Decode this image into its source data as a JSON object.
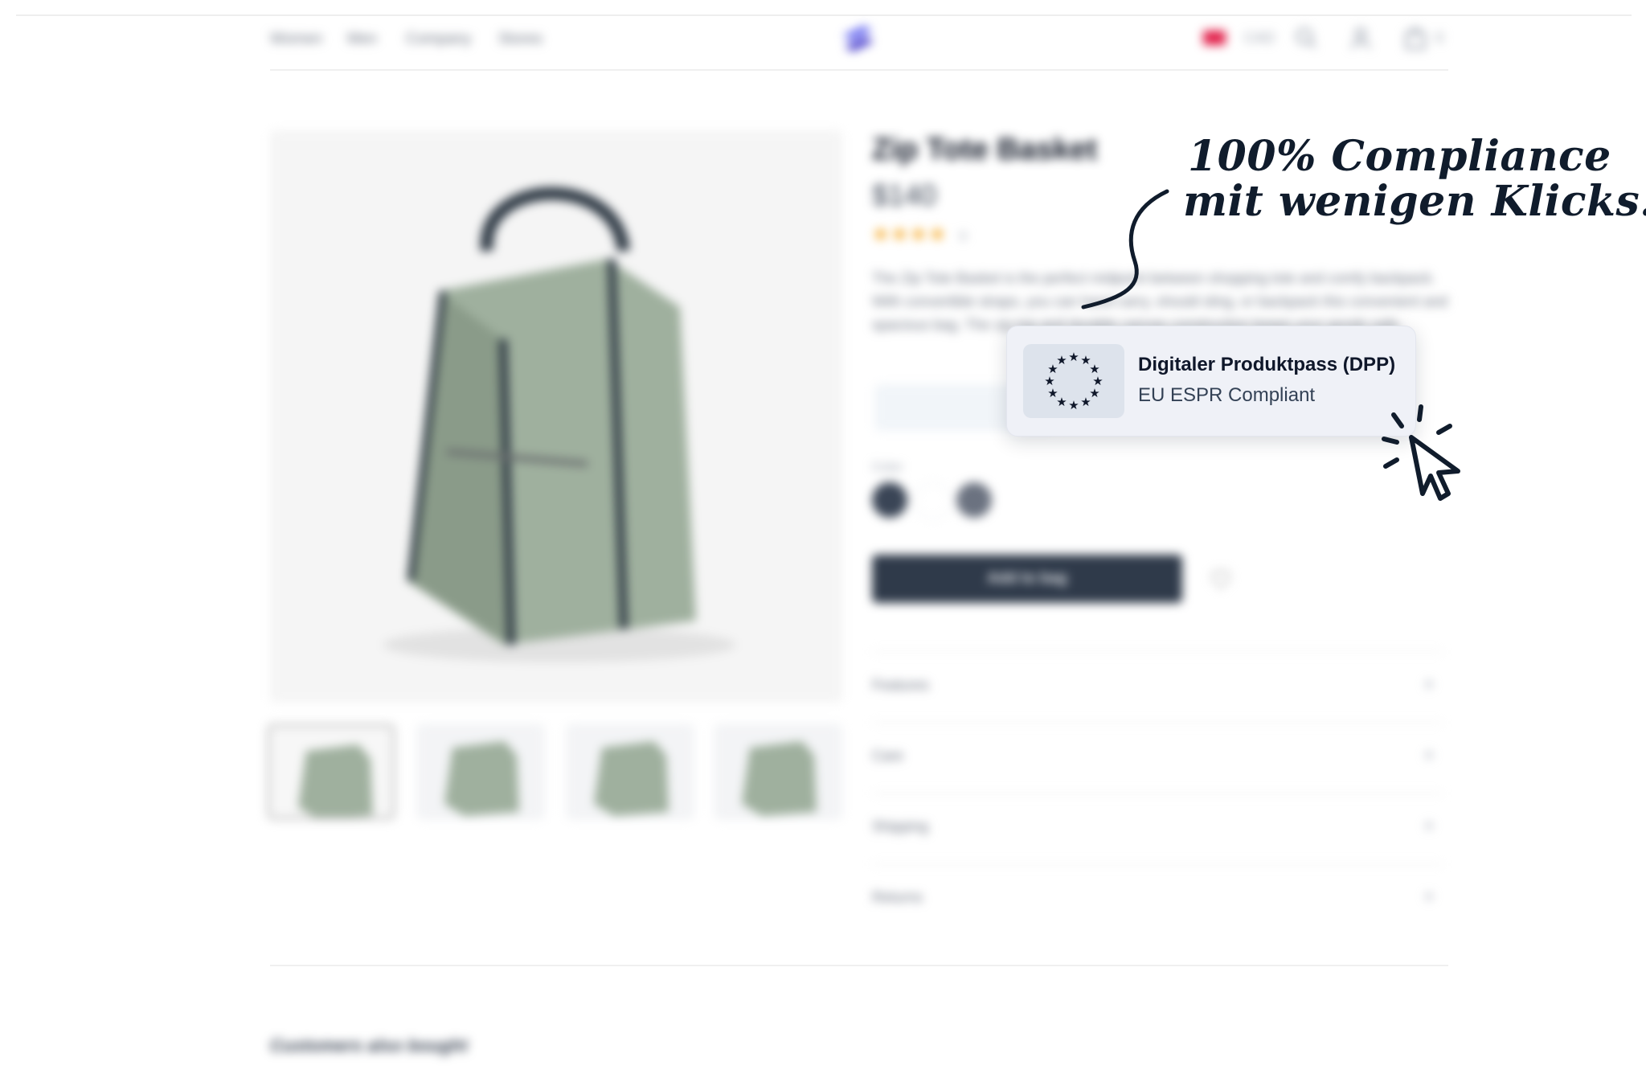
{
  "header": {
    "nav": [
      "Women",
      "Men",
      "Company",
      "Stores"
    ],
    "currency": "CAD",
    "cart_count": "0",
    "icons": [
      "logo-icon",
      "flag-icon",
      "search-icon",
      "account-icon",
      "bag-icon"
    ]
  },
  "product": {
    "title": "Zip Tote Basket",
    "price": "$140",
    "rating_stars": "★★★★",
    "rating_count": "9",
    "description": "The Zip Tote Basket is the perfect midpoint between shopping tote and comfy backpack. With convertible straps, you can hand carry, should sling, or backpack this convenient and spacious bag. The zip top and durable canvas construction keeps your goods safe.",
    "color_label": "Color",
    "colors": [
      "#3a4556",
      "#ffffff",
      "#6b7280"
    ],
    "add_to_bag": "Add to bag",
    "accordion": [
      "Features",
      "Care",
      "Shipping",
      "Returns"
    ],
    "accordion_icon": "+"
  },
  "section": {
    "also_bought": "Customers also bought"
  },
  "callout": {
    "headline_line1": "100% Compliance",
    "headline_line2": "mit wenigen Klicks!",
    "card_title": "Digitaler Produktpass (DPP)",
    "card_subtitle": "EU ESPR Compliant"
  }
}
